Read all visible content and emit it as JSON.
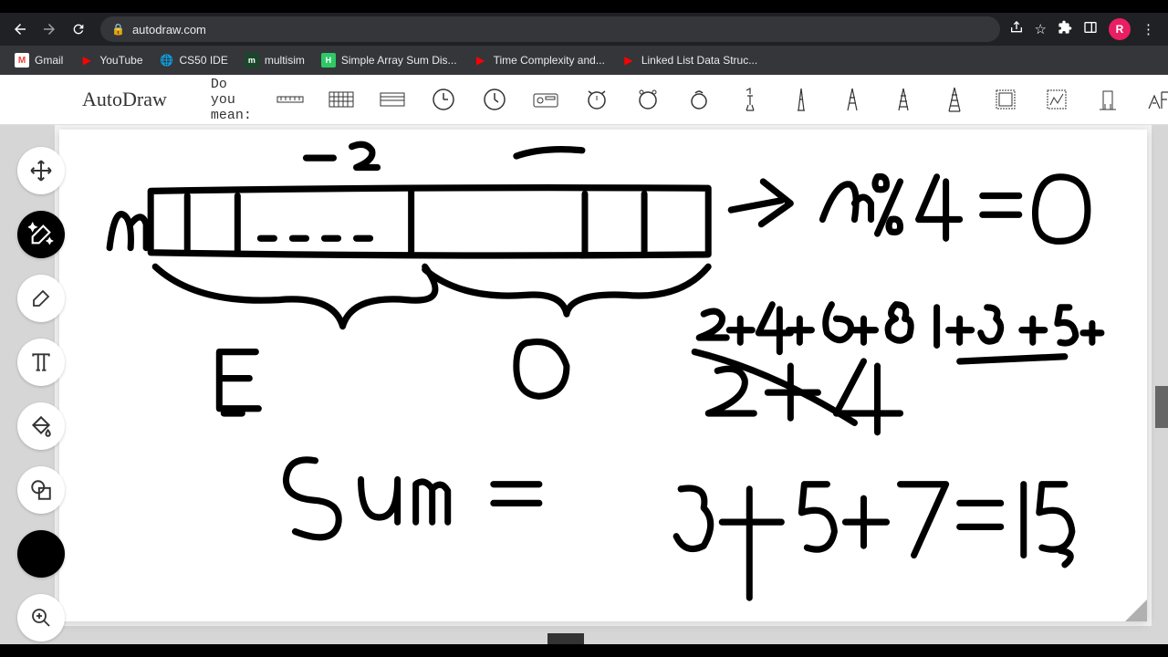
{
  "browser": {
    "url": "autodraw.com",
    "avatar_letter": "R",
    "bookmarks": [
      {
        "label": "Gmail",
        "icon": "gmail"
      },
      {
        "label": "YouTube",
        "icon": "youtube"
      },
      {
        "label": "CS50 IDE",
        "icon": "globe"
      },
      {
        "label": "multisim",
        "icon": "multisim"
      },
      {
        "label": "Simple Array Sum Dis...",
        "icon": "hackerrank"
      },
      {
        "label": "Time Complexity and...",
        "icon": "youtube"
      },
      {
        "label": "Linked List Data Struc...",
        "icon": "youtube"
      }
    ]
  },
  "app": {
    "title": "AutoDraw",
    "suggest_label": "Do you mean:",
    "suggestions": [
      "ruler",
      "keyboard1",
      "keyboard2",
      "clock-round",
      "clock-square",
      "radio",
      "alarm1",
      "alarm2",
      "alarm3",
      "statue",
      "tower1",
      "eiffel1",
      "eiffel2",
      "eiffel3",
      "stamp1",
      "stamp2",
      "building",
      "complex"
    ]
  },
  "tools": {
    "move": "move-tool",
    "autodraw": "autodraw",
    "draw": "draw",
    "text": "type",
    "fill": "fill",
    "shape": "shape",
    "color": "color-picker",
    "zoom": "zoom"
  },
  "drawing_notes": {
    "top_labels": [
      "-2"
    ],
    "array_label": "n",
    "groups": [
      "E",
      "O"
    ],
    "equation1": "n % 4 = 0",
    "equation2": "2+4+6+8  1+3+5+",
    "equation3": "2+4",
    "center": "Sum =",
    "bottom": "3+5+7=15"
  }
}
